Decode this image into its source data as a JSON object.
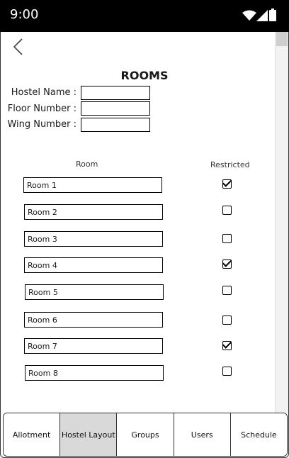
{
  "status_bar": {
    "time": "9:00",
    "icons": [
      "wifi-icon",
      "signal-icon",
      "battery-icon"
    ]
  },
  "header": {
    "back_icon": "chevron-left-icon",
    "title": "ROOMS"
  },
  "form": {
    "hostel_name_label": "Hostel Name :",
    "floor_number_label": "Floor Number :",
    "wing_number_label": "Wing Number :",
    "hostel_name_value": "",
    "floor_number_value": "",
    "wing_number_value": ""
  },
  "table": {
    "col_room": "Room",
    "col_restricted": "Restricted",
    "rows": [
      {
        "room": "Room 1",
        "restricted": true
      },
      {
        "room": "Room 2",
        "restricted": false
      },
      {
        "room": "Room 3",
        "restricted": false
      },
      {
        "room": "Room 4",
        "restricted": true
      },
      {
        "room": "Room 5",
        "restricted": false
      },
      {
        "room": "Room 6",
        "restricted": false
      },
      {
        "room": "Room 7",
        "restricted": true
      },
      {
        "room": "Room 8",
        "restricted": false
      }
    ]
  },
  "tabs": [
    {
      "label": "Allotment",
      "active": false
    },
    {
      "label": "Hostel Layout",
      "active": true
    },
    {
      "label": "Groups",
      "active": false
    },
    {
      "label": "Users",
      "active": false
    },
    {
      "label": "Schedule",
      "active": false
    }
  ]
}
